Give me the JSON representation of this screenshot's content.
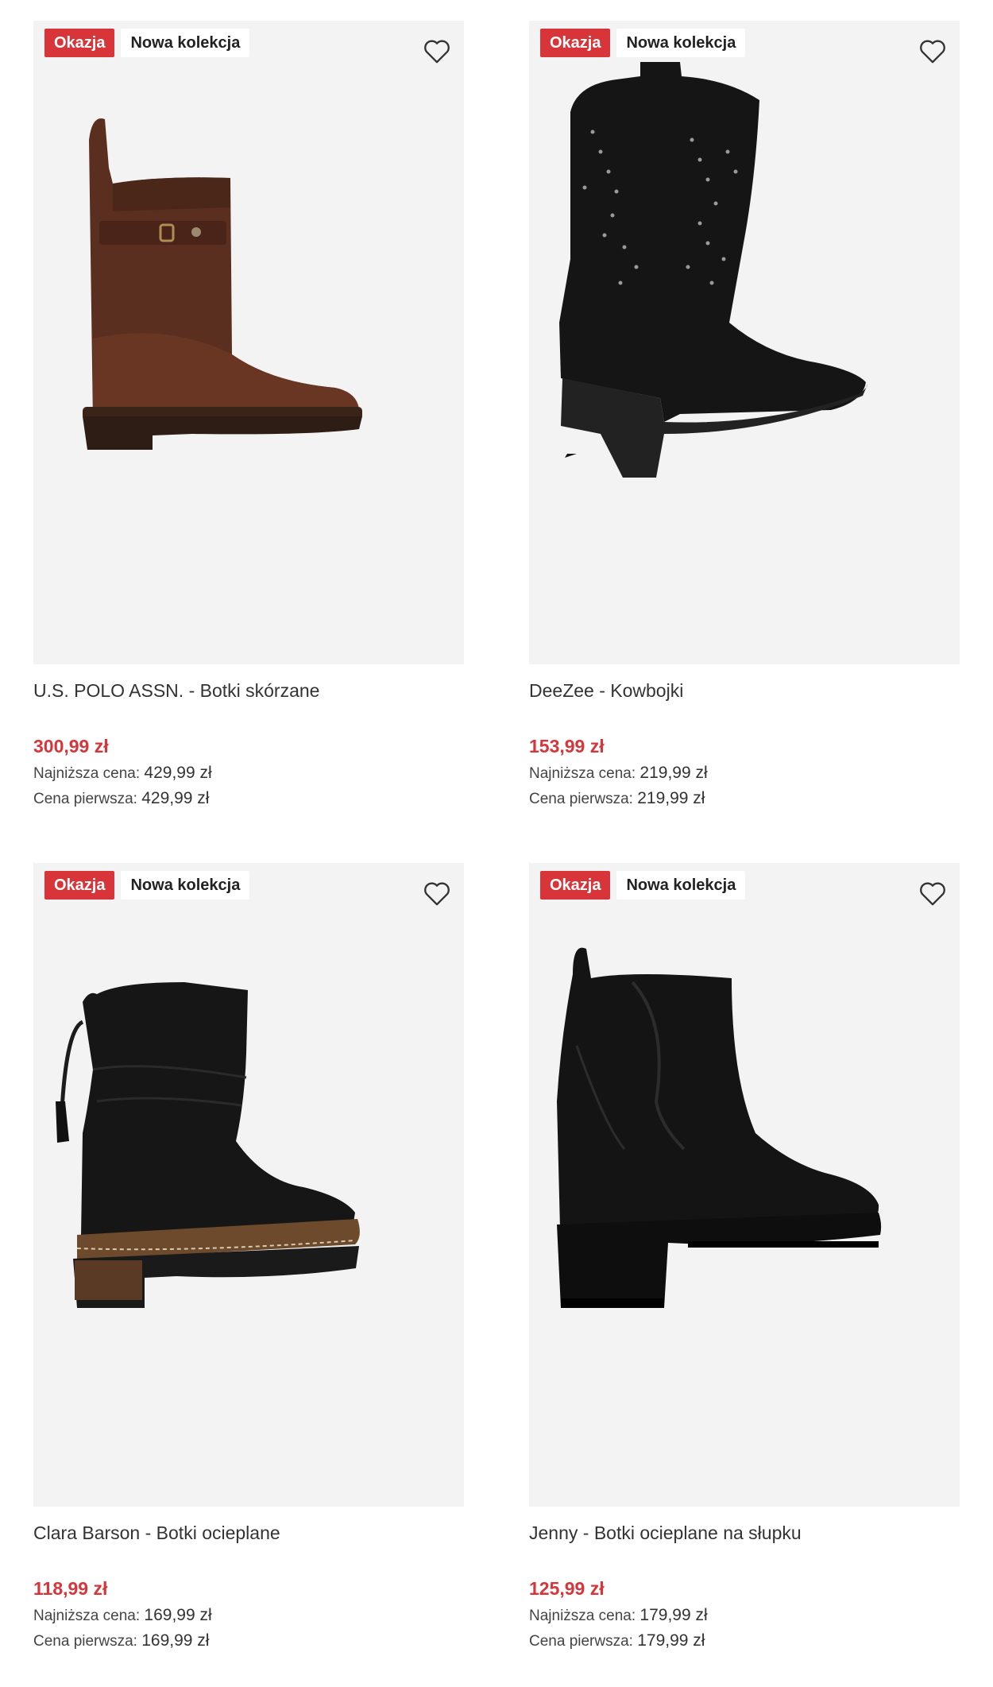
{
  "colors": {
    "sale": "#d8353a",
    "card_bg": "#f3f3f3"
  },
  "products": [
    {
      "badge_sale": "Okazja",
      "badge_new": "Nowa kolekcja",
      "icon": "heart-icon",
      "title": "U.S. POLO ASSN. - Botki skórzane",
      "price": "300,99 zł",
      "lowest_label": "Najniższa cena:",
      "lowest_value": "429,99 zł",
      "first_label": "Cena pierwsza:",
      "first_value": "429,99 zł"
    },
    {
      "badge_sale": "Okazja",
      "badge_new": "Nowa kolekcja",
      "icon": "heart-icon",
      "title": "DeeZee - Kowbojki",
      "price": "153,99 zł",
      "lowest_label": "Najniższa cena:",
      "lowest_value": "219,99 zł",
      "first_label": "Cena pierwsza:",
      "first_value": "219,99 zł"
    },
    {
      "badge_sale": "Okazja",
      "badge_new": "Nowa kolekcja",
      "icon": "heart-icon",
      "title": "Clara Barson - Botki ocieplane",
      "price": "118,99 zł",
      "lowest_label": "Najniższa cena:",
      "lowest_value": "169,99 zł",
      "first_label": "Cena pierwsza:",
      "first_value": "169,99 zł"
    },
    {
      "badge_sale": "Okazja",
      "badge_new": "Nowa kolekcja",
      "icon": "heart-icon",
      "title": "Jenny - Botki ocieplane na słupku",
      "price": "125,99 zł",
      "lowest_label": "Najniższa cena:",
      "lowest_value": "179,99 zł",
      "first_label": "Cena pierwsza:",
      "first_value": "179,99 zł"
    }
  ]
}
